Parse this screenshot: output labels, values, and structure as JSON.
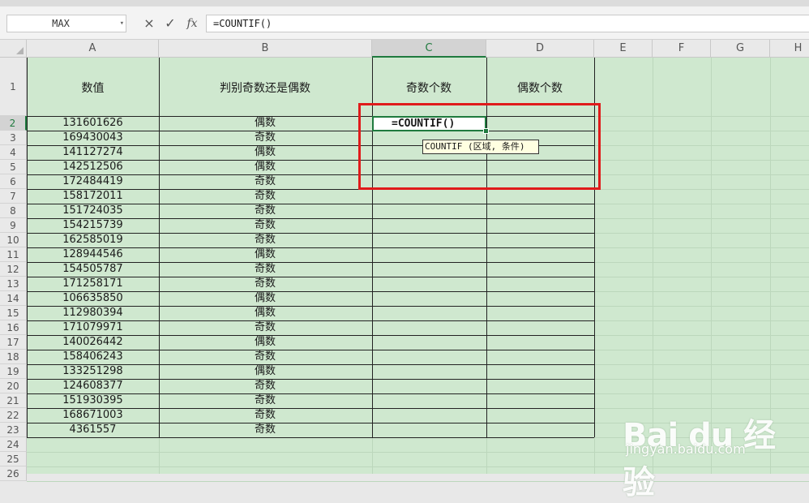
{
  "formula_bar": {
    "name_box": "MAX",
    "name_box_arrow": "▾",
    "cancel_icon": "×",
    "confirm_icon": "✓",
    "fx_label": "fx",
    "formula": "=COUNTIF()"
  },
  "columns": [
    "A",
    "B",
    "C",
    "D",
    "E",
    "F",
    "G",
    "H"
  ],
  "selected_column": "C",
  "row_numbers": [
    "1",
    "2",
    "3",
    "4",
    "5",
    "6",
    "7",
    "8",
    "9",
    "10",
    "11",
    "12",
    "13",
    "14",
    "15",
    "16",
    "17",
    "18",
    "19",
    "20",
    "21",
    "22",
    "23",
    "24",
    "25",
    "26"
  ],
  "header_row": {
    "a": "数值",
    "b": "判别奇数还是偶数",
    "c": "奇数个数",
    "d": "偶数个数"
  },
  "rows": [
    {
      "value": "131601626",
      "parity": "偶数"
    },
    {
      "value": "169430043",
      "parity": "奇数"
    },
    {
      "value": "141127274",
      "parity": "偶数"
    },
    {
      "value": "142512506",
      "parity": "偶数"
    },
    {
      "value": "172484419",
      "parity": "奇数"
    },
    {
      "value": "158172011",
      "parity": "奇数"
    },
    {
      "value": "151724035",
      "parity": "奇数"
    },
    {
      "value": "154215739",
      "parity": "奇数"
    },
    {
      "value": "162585019",
      "parity": "奇数"
    },
    {
      "value": "128944546",
      "parity": "偶数"
    },
    {
      "value": "154505787",
      "parity": "奇数"
    },
    {
      "value": "171258171",
      "parity": "奇数"
    },
    {
      "value": "106635850",
      "parity": "偶数"
    },
    {
      "value": "112980394",
      "parity": "偶数"
    },
    {
      "value": "171079971",
      "parity": "奇数"
    },
    {
      "value": "140026442",
      "parity": "偶数"
    },
    {
      "value": "158406243",
      "parity": "奇数"
    },
    {
      "value": "133251298",
      "parity": "偶数"
    },
    {
      "value": "124608377",
      "parity": "奇数"
    },
    {
      "value": "151930395",
      "parity": "奇数"
    },
    {
      "value": "168671003",
      "parity": "奇数"
    },
    {
      "value": "4361557",
      "parity": "奇数"
    }
  ],
  "active_cell": {
    "ref": "C2",
    "content": "=COUNTIF()"
  },
  "tooltip": "COUNTIF (区域, 条件)",
  "watermark": {
    "logo": "Bai du 经验",
    "url": "jingyan.baidu.com"
  },
  "colors": {
    "grid_bg": "#cfe8cf",
    "selection": "#1f7a3e",
    "highlight_box": "#e01b1b",
    "tooltip_bg": "#ffffe1"
  }
}
